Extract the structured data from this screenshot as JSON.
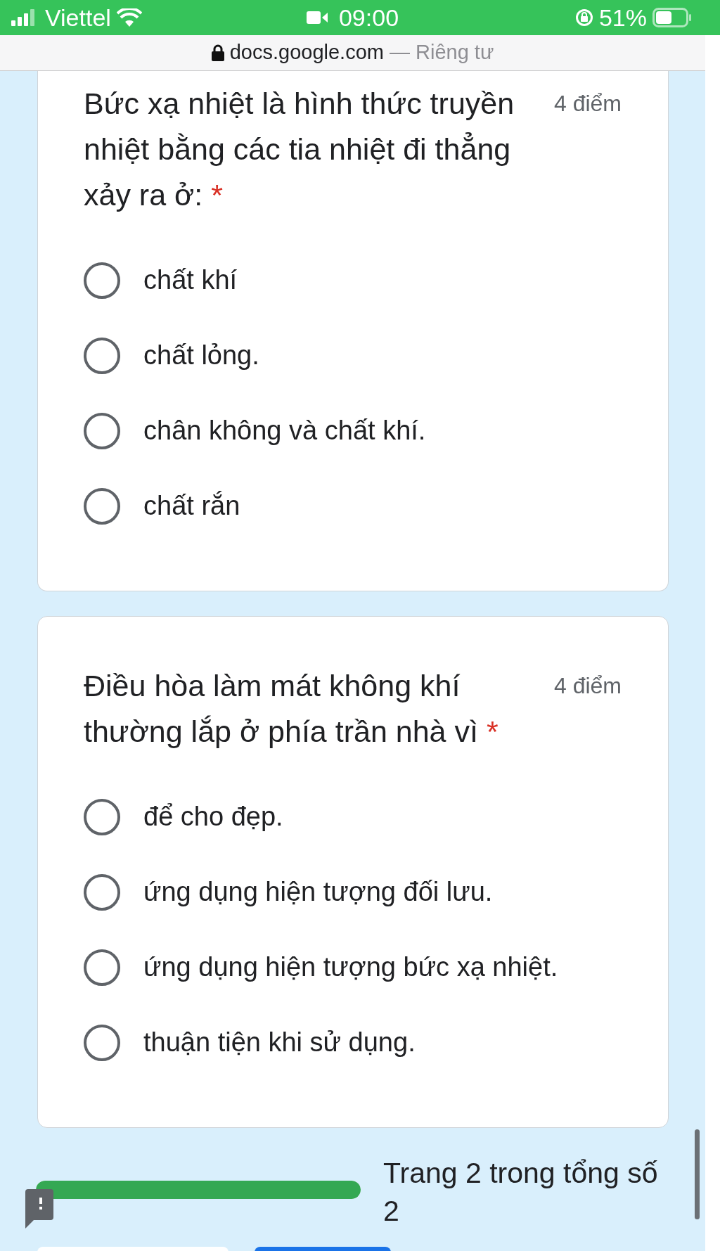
{
  "status_bar": {
    "carrier": "Viettel",
    "time": "09:00",
    "battery": "51%"
  },
  "address_bar": {
    "domain": "docs.google.com",
    "note": "— Riêng tư"
  },
  "questions": [
    {
      "text": "Bức xạ nhiệt là hình thức truyền nhiệt bằng các tia nhiệt đi thẳng xảy ra ở:",
      "required_mark": "*",
      "points": "4 điểm",
      "options": [
        {
          "label": "chất khí",
          "selected": false
        },
        {
          "label": "chất lỏng.",
          "selected": false
        },
        {
          "label": "chân không và chất khí.",
          "selected": false
        },
        {
          "label": "chất rắn",
          "selected": false
        }
      ]
    },
    {
      "text": "Điều hòa làm mát không khí thường lắp ở phía trần nhà vì",
      "required_mark": "*",
      "points": "4 điểm",
      "options": [
        {
          "label": "để cho đẹp.",
          "selected": false
        },
        {
          "label": "ứng dụng hiện tượng đối lưu.",
          "selected": false
        },
        {
          "label": "ứng dụng hiện tượng bức xạ nhiệt.",
          "selected": false
        },
        {
          "label": "thuận tiện khi sử dụng.",
          "selected": false
        }
      ]
    }
  ],
  "progress": {
    "level": 1,
    "text": "Trang 2 trong tổng số 2"
  }
}
